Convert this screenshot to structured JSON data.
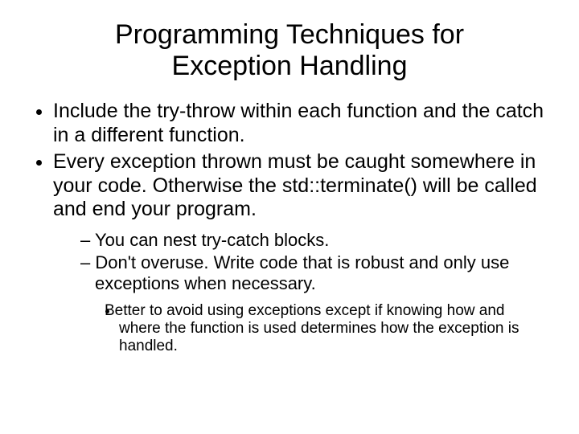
{
  "title": "Programming Techniques for Exception Handling",
  "bullets": {
    "item1": "Include the try-throw within each function and the catch in a different function.",
    "item2": "Every exception thrown must be caught somewhere in your code.  Otherwise the std::terminate() will be called and end your program.",
    "sub1": "You can nest try-catch blocks.",
    "sub2": "Don't overuse.  Write code that is robust and only use exceptions when necessary.",
    "subsub1": "Better to avoid using exceptions except if knowing how and where the function is used  determines how the exception is handled."
  }
}
